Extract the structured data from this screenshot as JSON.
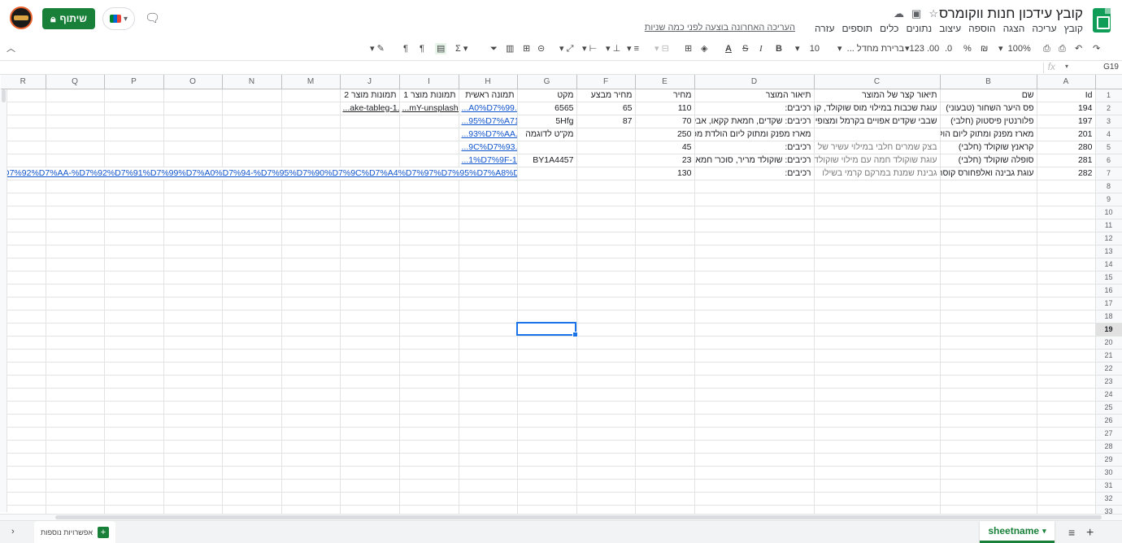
{
  "app": {
    "title": "קובץ עידכון חנות ווקומרס",
    "last_edit": "העריכה האחרונה בוצעה לפני כמה שניות",
    "share_label": "שיתוף",
    "menu": [
      "קובץ",
      "עריכה",
      "הצגה",
      "הוספה",
      "עיצוב",
      "נתונים",
      "כלים",
      "תוספים",
      "עזרה"
    ]
  },
  "toolbar": {
    "zoom": "100%",
    "currency": "₪",
    "percent": "%",
    "dec_decrease": ".0",
    "dec_increase": ".00",
    "format": "123",
    "font": "ברירת מחדל ...",
    "font_size": "10",
    "bold": "B",
    "italic": "I",
    "strike": "S",
    "text_color": "A",
    "sum": "Σ"
  },
  "formula_bar": {
    "cell_ref": "G19",
    "fx": "fx",
    "formula": ""
  },
  "columns": [
    "A",
    "B",
    "C",
    "D",
    "E",
    "F",
    "G",
    "H",
    "I",
    "J",
    "M",
    "N",
    "O",
    "P",
    "Q",
    "R"
  ],
  "rows": [
    {
      "n": "1",
      "A": "Id",
      "B": "שם",
      "C": "תיאור קצר של המוצר",
      "D": "תיאור המוצר",
      "E": "מחיר",
      "F": "מחיר מבצע",
      "G": "מקט",
      "H": "תמונה ראשית",
      "I": "תמונות מוצר 1",
      "J": "תמונות מוצר 2",
      "M": "",
      "N": "",
      "O": "",
      "P": "",
      "Q": "",
      "R": ""
    },
    {
      "n": "2",
      "A": "194",
      "B": "פס היער השחור (טבעוני)",
      "C": "עוגת שכבות במילוי מוס שוקולד, קרם",
      "D": "רכיבים:",
      "E": "110",
      "F": "65",
      "G": "6565",
      "H": "...A0%D7%99.jpg",
      "I": "...mY-unsplash.jpg",
      "J": "...ake-tableg-1.jpg",
      "M": "",
      "N": "",
      "O": "",
      "P": "",
      "Q": "",
      "R": ""
    },
    {
      "n": "3",
      "A": "197",
      "B": "פלורנטין פיסטוק (חלבי)",
      "C": "שבבי שקדים אפויים בקרמל ומצופים ב",
      "D": "רכיבים: שקדים, חמאת קקאו, אבקת",
      "E": "70",
      "F": "87",
      "G": "5Hfg",
      "H": "...95%D7%A71.jpg",
      "I": "",
      "J": "",
      "M": "",
      "N": "",
      "O": "",
      "P": "",
      "Q": "",
      "R": ""
    },
    {
      "n": "4",
      "A": "201",
      "B": "מארז מפנק ומתוק ליום הולדת",
      "C": "",
      "D": "מארז מפנק ומתוק ליום הולדת מכיל:",
      "E": "250",
      "F": "",
      "G": "מק\"ט לדוגמה",
      "H": "...93%D7%AA.jpg",
      "I": "",
      "J": "",
      "M": "",
      "N": "",
      "O": "",
      "P": "",
      "Q": "",
      "R": ""
    },
    {
      "n": "5",
      "A": "280",
      "B": "קראנץ שוקולד (חלבי)",
      "C": "בצק שמרים חלבי במילוי עשיר של",
      "D": "רכיבים:",
      "E": "45",
      "F": "",
      "G": "",
      "H": "...9C%D7%93.jpg",
      "I": "",
      "J": "",
      "M": "",
      "N": "",
      "O": "",
      "P": "",
      "Q": "",
      "R": ""
    },
    {
      "n": "6",
      "A": "281",
      "B": "סופלה שוקולד (חלבי)",
      "C": "עוגת שוקולד חמה עם מילוי שוקולד",
      "D": "רכיבים: שוקולד מריר, סוכר' חמאה,",
      "E": "23",
      "F": "",
      "G": "BY1A4457",
      "H": "...1%D7%9F-1.jpg",
      "I": "",
      "J": "",
      "M": "",
      "N": "",
      "O": "",
      "P": "",
      "Q": "",
      "R": ""
    },
    {
      "n": "7",
      "A": "282",
      "B": "עוגת גבינה ואלפחורס קוסר (",
      "C": "גבינת שמנת במרקם קרמי בשילו",
      "D": "רכיבים:",
      "E": "130",
      "F": "",
      "G": "",
      "H": "D7%92%D7%AA-%D7%92%D7%91%D7%99%D7%A0%D7%94-%D7%95%D7%90%D7%9C%D7%A4%D7%97%D7%95%D7%A8%D7%A11.jpg",
      "I": "",
      "J": "",
      "M": "",
      "N": "",
      "O": "",
      "P": "",
      "Q": "",
      "R": ""
    }
  ],
  "empty_row_numbers": [
    "8",
    "9",
    "10",
    "11",
    "12",
    "13",
    "14",
    "15",
    "16",
    "17",
    "18",
    "19",
    "20",
    "21",
    "22",
    "23",
    "24",
    "25",
    "26",
    "27",
    "28",
    "29",
    "30",
    "31",
    "32",
    "33"
  ],
  "selected_row": "19",
  "bottom": {
    "sheet_name": "sheetname",
    "explore_label": "אפשרויות נוספות"
  },
  "colors": {
    "accent": "#188038",
    "link": "#1155cc",
    "selection": "#1a73e8"
  }
}
